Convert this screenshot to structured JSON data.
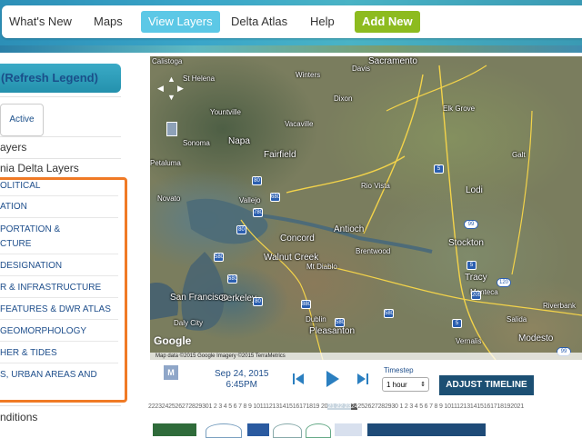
{
  "nav": {
    "items": [
      {
        "label": "What's New"
      },
      {
        "label": "Maps"
      },
      {
        "label": "View Layers"
      },
      {
        "label": "Delta Atlas"
      },
      {
        "label": "Help"
      },
      {
        "label": "Add New"
      }
    ]
  },
  "legend": {
    "refresh_label": "(Refresh Legend)",
    "active_label": "Active",
    "layers_label": "ayers",
    "delta_layers_label": "nia Delta Layers",
    "categories": [
      {
        "label": "OLITICAL"
      },
      {
        "label": "ATION"
      },
      {
        "label": "PORTATION &"
      },
      {
        "label": "CTURE"
      },
      {
        "label": "DESIGNATION"
      },
      {
        "label": "R & INFRASTRUCTURE"
      },
      {
        "label": " FEATURES & DWR ATLAS"
      },
      {
        "label": " GEOMORPHOLOGY"
      },
      {
        "label": "HER & TIDES"
      },
      {
        "label": "S, URBAN AREAS AND"
      }
    ],
    "conditions_label": "nditions"
  },
  "map": {
    "places": [
      {
        "label": "Calistoga"
      },
      {
        "label": "Sacramento"
      },
      {
        "label": "Davis"
      },
      {
        "label": "Winters"
      },
      {
        "label": "St Helena"
      },
      {
        "label": "Dixon"
      },
      {
        "label": "Yountville"
      },
      {
        "label": "Vacaville"
      },
      {
        "label": "Elk Grove"
      },
      {
        "label": "Sonoma"
      },
      {
        "label": "Napa"
      },
      {
        "label": "Fairfield"
      },
      {
        "label": "Galt"
      },
      {
        "label": "Rio Vista"
      },
      {
        "label": "Lodi"
      },
      {
        "label": "Novato"
      },
      {
        "label": "Vallejo"
      },
      {
        "label": "Concord"
      },
      {
        "label": "Antioch"
      },
      {
        "label": "Stockton"
      },
      {
        "label": "Brentwood"
      },
      {
        "label": "Walnut Creek"
      },
      {
        "label": "Mt Diablo"
      },
      {
        "label": "Berkeley"
      },
      {
        "label": "San Francisco"
      },
      {
        "label": "Tracy"
      },
      {
        "label": "Manteca"
      },
      {
        "label": "Daly City"
      },
      {
        "label": "Dublin"
      },
      {
        "label": "Pleasanton"
      },
      {
        "label": "Salida"
      },
      {
        "label": "Modesto"
      },
      {
        "label": "Riverbank"
      },
      {
        "label": "Vernalis"
      },
      {
        "label": "Petaluma"
      }
    ],
    "shields": [
      "80",
      "5",
      "80",
      "780",
      "80",
      "680",
      "580",
      "880",
      "680",
      "580",
      "5",
      "205",
      "580",
      "99",
      "120",
      "5",
      "99"
    ],
    "google_label": "Google",
    "attribution": "Map data ©2015 Google Imagery ©2015 TerraMetrics"
  },
  "timeline": {
    "m_label": "M",
    "date_line1": "Sep 24, 2015",
    "date_line2": "6:45PM",
    "timestep_label": "Timestep",
    "timestep_value": "1 hour",
    "adjust_label": "ADJUST TIMELINE",
    "ticks_before": "2223242526272829301 2 3 4 5 6 7 8 9 10111213141516171819 20",
    "ticks_hl": "21 22 23",
    "ticks_hl2": "24",
    "ticks_after": "252627282930 1 2 3 4 5 6 7 8 9 101112131415161718192021"
  },
  "colors": {
    "accent": "#5cc8e6",
    "add_new": "#8dbb1f",
    "highlight_box": "#f07a25",
    "adjust_button": "#1c4f73"
  }
}
